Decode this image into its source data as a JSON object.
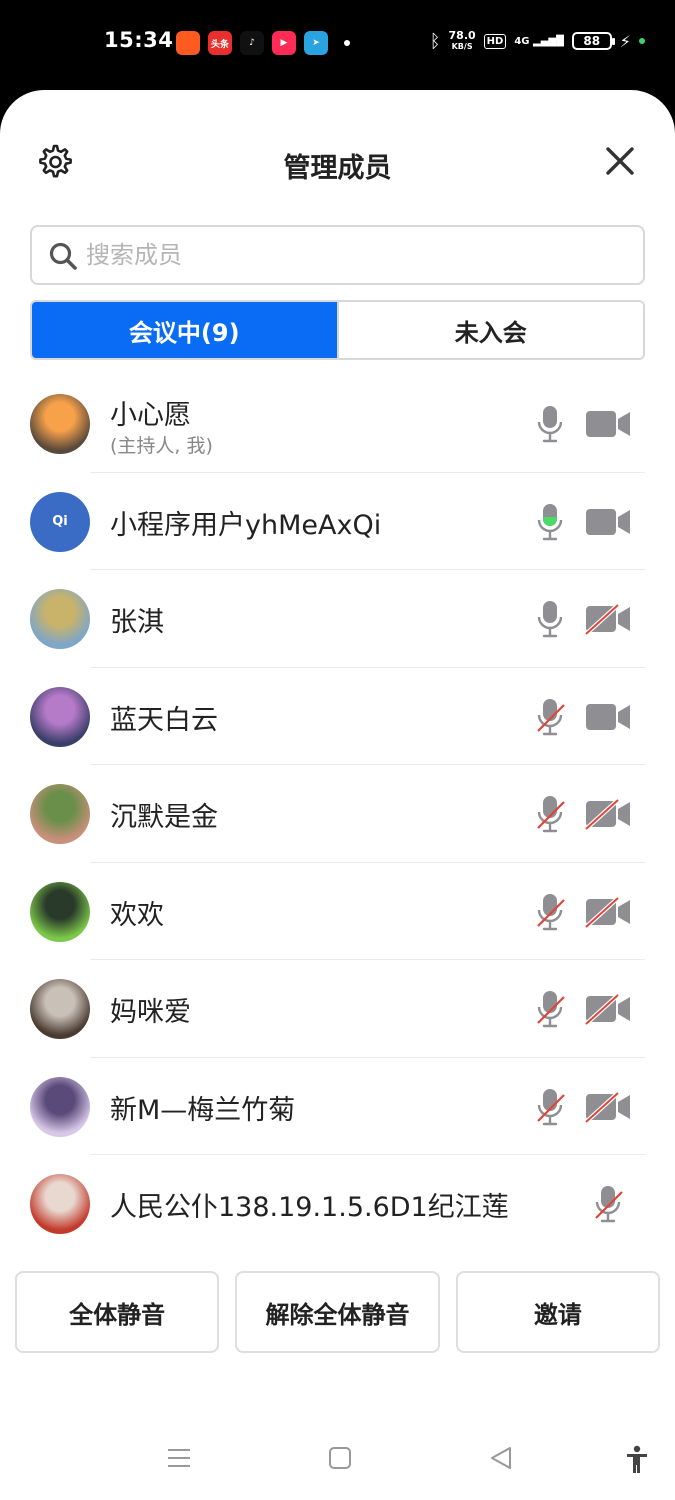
{
  "status": {
    "time": "15:34",
    "apps": [
      {
        "icon": "kuaishou-icon",
        "color": "#ff5a1f",
        "text": ""
      },
      {
        "icon": "toutiao-icon",
        "color": "#e8302e",
        "text": "头条"
      },
      {
        "icon": "tiktok-icon",
        "color": "#111111",
        "text": "♪"
      },
      {
        "icon": "video-icon",
        "color": "#ff2d55",
        "text": "▶"
      },
      {
        "icon": "telegram-icon",
        "color": "#2aa3e0",
        "text": "➤"
      }
    ],
    "speed_value": "78.0",
    "speed_unit": "KB/S",
    "hd": "HD",
    "network": "4G",
    "battery": "88"
  },
  "header": {
    "title": "管理成员"
  },
  "search": {
    "placeholder": "搜索成员"
  },
  "tabs": [
    {
      "label": "会议中(9)",
      "active": true
    },
    {
      "label": "未入会",
      "active": false
    }
  ],
  "members": [
    {
      "name": "小心愿",
      "sub": "(主持人, 我)",
      "avatar": "photo",
      "colors": [
        "#f7a14a",
        "#5a4a3c"
      ],
      "mic": "on",
      "cam": "on"
    },
    {
      "name": "小程序用户yhMeAxQi",
      "sub": "",
      "avatar": "initials",
      "initials": "Qi",
      "mic": "speaking",
      "cam": "on"
    },
    {
      "name": "张淇",
      "sub": "",
      "avatar": "photo",
      "colors": [
        "#c9b36a",
        "#7da6c9"
      ],
      "mic": "on",
      "cam": "off"
    },
    {
      "name": "蓝天白云",
      "sub": "",
      "avatar": "photo",
      "colors": [
        "#b57ac8",
        "#3a3f6a"
      ],
      "mic": "off",
      "cam": "on"
    },
    {
      "name": "沉默是金",
      "sub": "",
      "avatar": "photo",
      "colors": [
        "#6a8f4a",
        "#c98f7a"
      ],
      "mic": "off",
      "cam": "off"
    },
    {
      "name": "欢欢",
      "sub": "",
      "avatar": "photo",
      "colors": [
        "#2a3a2a",
        "#7cc84a"
      ],
      "mic": "off",
      "cam": "off"
    },
    {
      "name": "妈咪爱",
      "sub": "",
      "avatar": "photo",
      "colors": [
        "#c9c0b8",
        "#4a3a30"
      ],
      "mic": "off",
      "cam": "off"
    },
    {
      "name": "新M—梅兰竹菊",
      "sub": "",
      "avatar": "photo",
      "colors": [
        "#5a4a7a",
        "#d8c8e8"
      ],
      "mic": "off",
      "cam": "off"
    },
    {
      "name": "人民公仆138.19.1.5.6D1纪江莲",
      "sub": "",
      "avatar": "photo",
      "colors": [
        "#e8d8d0",
        "#c23a2a"
      ],
      "mic": "off",
      "cam": "none"
    }
  ],
  "actions": {
    "mute_all": "全体静音",
    "unmute_all": "解除全体静音",
    "invite": "邀请"
  },
  "colors": {
    "accent": "#0a6cf5",
    "icon_gray": "#8e8e93",
    "speaking_green": "#4cd964",
    "muted_red": "#e0453a"
  }
}
